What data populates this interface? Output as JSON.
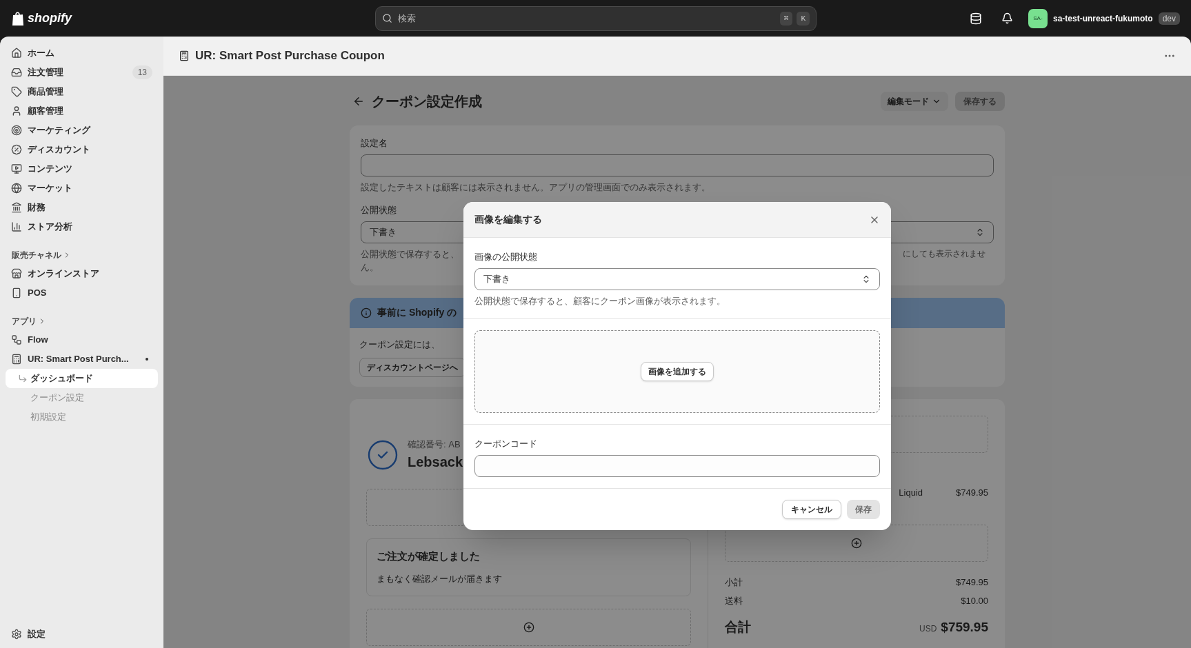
{
  "topbar": {
    "logo": "shopify",
    "search": {
      "placeholder": "検索",
      "keys": [
        "⌘",
        "K"
      ]
    },
    "account": {
      "avatar": "SA-",
      "name": "sa-test-unreact-fukumoto",
      "badge": "dev"
    }
  },
  "sidebar": {
    "main_items": [
      {
        "label": "ホーム"
      },
      {
        "label": "注文管理",
        "count": "13"
      },
      {
        "label": "商品管理"
      },
      {
        "label": "顧客管理"
      },
      {
        "label": "マーケティング"
      },
      {
        "label": "ディスカウント"
      },
      {
        "label": "コンテンツ"
      },
      {
        "label": "マーケット"
      },
      {
        "label": "財務"
      },
      {
        "label": "ストア分析"
      }
    ],
    "sections": [
      {
        "title": "販売チャネル",
        "items": [
          {
            "label": "オンラインストア"
          },
          {
            "label": "POS"
          }
        ]
      },
      {
        "title": "アプリ",
        "items": [
          {
            "label": "Flow"
          },
          {
            "label": "UR: Smart Post Purch...",
            "children": [
              {
                "label": "ダッシュボード",
                "selected": true
              },
              {
                "label": "クーポン設定",
                "selected": false
              },
              {
                "label": "初期設定",
                "selected": false
              }
            ]
          }
        ]
      }
    ],
    "settings": "設定"
  },
  "app_header": {
    "title": "UR: Smart Post Purchase Coupon"
  },
  "page": {
    "title": "クーポン設定作成",
    "mode_button": "編集モード",
    "save_button": {
      "label": "保存する",
      "disabled": true
    },
    "settings_card": {
      "name_label": "設定名",
      "name_hint": "設定したテキストは顧客には表示されません。アプリの管理画面でのみ表示されます。",
      "status_label": "公開状態",
      "status_value": "下書き",
      "status_hint_left": "公開状態で保存すると、",
      "status_hint_right": "にしても表示されませ",
      "status_hint_end": "ん。"
    },
    "banner": {
      "title": "事前に Shopify の",
      "text": "クーポン設定には、",
      "button": "ディスカウントページへ"
    },
    "preview": {
      "confirmation": "確認番号: AB",
      "customer": "Lebsack",
      "order_card": {
        "title": "ご注文が確定しました",
        "text": "まもなく確認メールが届きます"
      },
      "product": {
        "name": "Liquid",
        "price": "$749.95"
      },
      "summary": [
        {
          "label": "小計",
          "value": "$749.95"
        },
        {
          "label": "送料",
          "value": "$10.00"
        }
      ],
      "total": {
        "label": "合計",
        "currency": "USD",
        "value": "$759.95"
      }
    }
  },
  "modal": {
    "title": "画像を編集する",
    "status_label": "画像の公開状態",
    "status_value": "下書き",
    "status_hint": "公開状態で保存すると、顧客にクーポン画像が表示されます。",
    "add_image_button": "画像を追加する",
    "code_label": "クーポンコード",
    "buttons": [
      {
        "label": "キャンセル",
        "kind": "secondary",
        "disabled": false
      },
      {
        "label": "保存",
        "kind": "primary",
        "disabled": true
      }
    ]
  }
}
